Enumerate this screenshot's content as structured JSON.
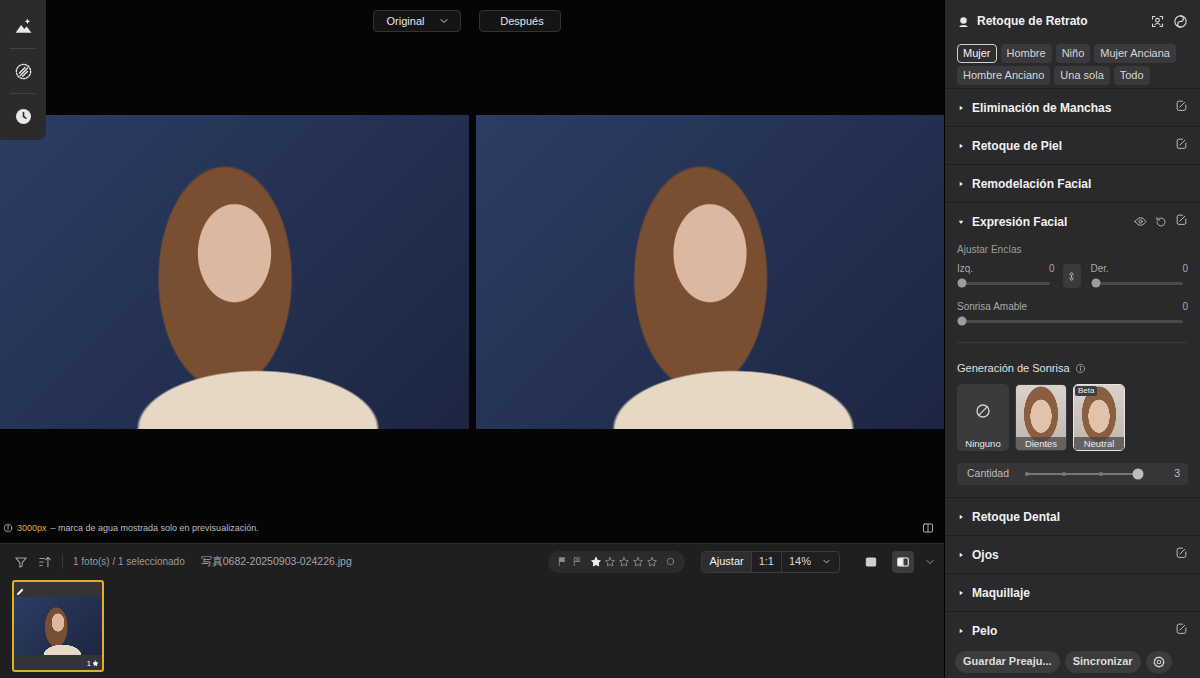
{
  "viewer": {
    "compare_dropdown": "Original",
    "after_button": "Después",
    "notice": {
      "size": "3000px",
      "text": "– marca de agua mostrada solo en previsualización."
    }
  },
  "filmstrip": {
    "count": "1 foto(s) / 1 seleccionado",
    "filename": "写真0682-20250903-024226.jpg",
    "stars": 1,
    "fit": "Ajustar",
    "actual_size": "1:1",
    "zoom": "14%",
    "view_modes": [
      {
        "kind": "single",
        "selected": false
      },
      {
        "kind": "compare",
        "selected": true
      }
    ],
    "thumbnails": [
      {
        "rating": "1",
        "selected": true,
        "edited": true
      }
    ]
  },
  "panel": {
    "title": "Retoque de Retrato",
    "presets": [
      {
        "label": "Mujer",
        "selected": true
      },
      {
        "label": "Hombre",
        "selected": false
      },
      {
        "label": "Niño",
        "selected": false
      },
      {
        "label": "Mujer Anciana",
        "selected": false
      },
      {
        "label": "Hombre Anciano",
        "selected": false
      },
      {
        "label": "Una sola",
        "selected": false
      },
      {
        "label": "Todo",
        "selected": false
      }
    ],
    "sections": [
      {
        "title": "Eliminación de Manchas",
        "expanded": false,
        "eraser": true
      },
      {
        "title": "Retoque de Piel",
        "expanded": false,
        "eraser": true
      },
      {
        "title": "Remodelación Facial",
        "expanded": false,
        "eraser": false
      },
      {
        "title": "Expresión Facial",
        "expanded": true,
        "eraser": true
      },
      {
        "title": "Retoque Dental",
        "expanded": false,
        "eraser": false
      },
      {
        "title": "Ojos",
        "expanded": false,
        "eraser": true
      },
      {
        "title": "Maquillaje",
        "expanded": false,
        "eraser": false
      },
      {
        "title": "Pelo",
        "expanded": false,
        "eraser": true
      }
    ],
    "expression": {
      "gums": {
        "label": "Ajustar Encías",
        "left": {
          "label": "Izq.",
          "value": "0",
          "level": 0
        },
        "right": {
          "label": "Der.",
          "value": "0",
          "level": 0
        }
      },
      "friendly": {
        "label": "Sonrisa Amable",
        "value": "0",
        "level": 0
      },
      "generation": {
        "title": "Generación de Sonrisa",
        "options": [
          {
            "label": "Ninguno",
            "kind": "none",
            "selected": false
          },
          {
            "label": "Dientes",
            "kind": "photo",
            "selected": false
          },
          {
            "label": "Neutral",
            "kind": "photo",
            "selected": true,
            "badge": "Beta"
          }
        ],
        "amount": {
          "label": "Cantidad",
          "value": "3",
          "level": 1
        }
      }
    },
    "buttons": [
      "Guardar Preaju...",
      "Sincronizar"
    ]
  }
}
